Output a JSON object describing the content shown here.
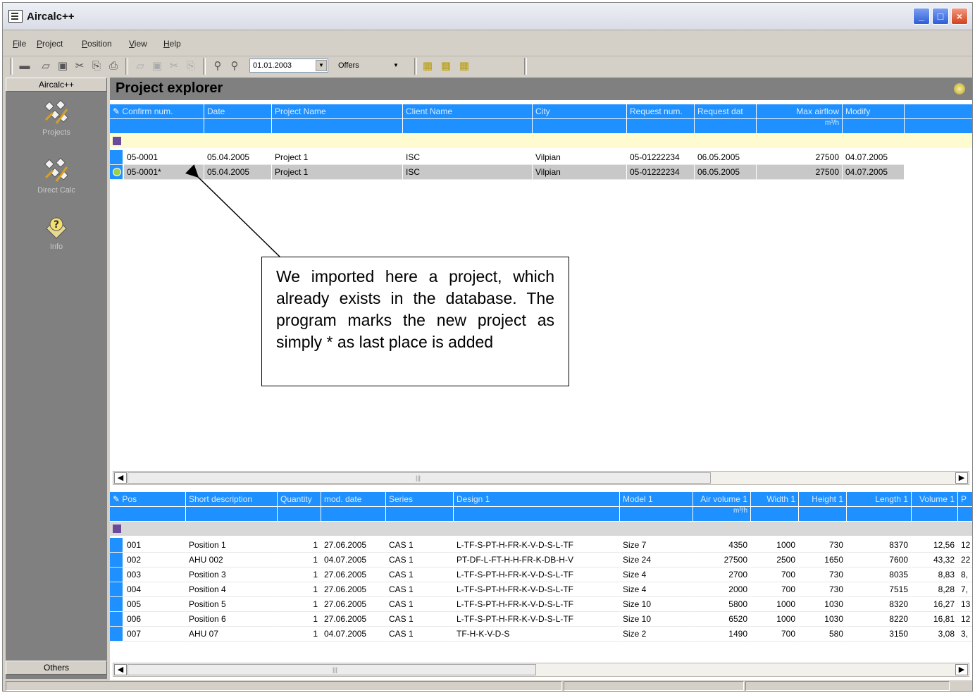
{
  "window": {
    "title": "Aircalc++"
  },
  "menu": [
    "File",
    "Project",
    "Position",
    "View",
    "Help"
  ],
  "toolbar": {
    "date_value": "01.01.2003",
    "offers_value": "Offers"
  },
  "leftbar": {
    "header": "Aircalc++",
    "items": [
      {
        "label": "Projects",
        "icon": "projects-icon"
      },
      {
        "label": "Direct Calc",
        "icon": "direct-calc-icon"
      },
      {
        "label": "Info",
        "icon": "info-icon"
      }
    ],
    "footer": "Others"
  },
  "explorer": {
    "title": "Project explorer"
  },
  "projects": {
    "columns": [
      "Confirm num.",
      "Date",
      "Project Name",
      "Client Name",
      "City",
      "Request num.",
      "Request dat",
      "Max airflow",
      "Modify"
    ],
    "column_sub": [
      "",
      "",
      "",
      "",
      "",
      "",
      "",
      "m³/h",
      ""
    ],
    "rows": [
      [
        "05-0001",
        "05.04.2005",
        "Project 1",
        "ISC",
        "Vilpian",
        "05-01222234",
        "06.05.2005",
        "27500",
        "04.07.2005"
      ],
      [
        "05-0001*",
        "05.04.2005",
        "Project 1",
        "ISC",
        "Vilpian",
        "05-01222234",
        "06.05.2005",
        "27500",
        "04.07.2005"
      ]
    ]
  },
  "positions": {
    "columns": [
      "Pos",
      "Short description",
      "Quantity",
      "mod. date",
      "Series",
      "Design 1",
      "Model 1",
      "Air volume 1",
      "Width 1",
      "Height 1",
      "Length 1",
      "Volume 1",
      "P"
    ],
    "column_sub": [
      "",
      "",
      "",
      "",
      "",
      "",
      "",
      "m³/h",
      "",
      "",
      "",
      "",
      ""
    ],
    "rows": [
      [
        "001",
        "Position 1",
        "1",
        "27.06.2005",
        "CAS 1",
        "L-TF-S-PT-H-FR-K-V-D-S-L-TF",
        "Size 7",
        "4350",
        "1000",
        "730",
        "8370",
        "12,56",
        "12"
      ],
      [
        "002",
        "AHU 002",
        "1",
        "04.07.2005",
        "CAS 1",
        "PT-DF-L-FT-H-H-FR-K-DB-H-V",
        "Size 24",
        "27500",
        "2500",
        "1650",
        "7600",
        "43,32",
        "22"
      ],
      [
        "003",
        "Position 3",
        "1",
        "27.06.2005",
        "CAS 1",
        "L-TF-S-PT-H-FR-K-V-D-S-L-TF",
        "Size 4",
        "2700",
        "700",
        "730",
        "8035",
        "8,83",
        "8,"
      ],
      [
        "004",
        "Position 4",
        "1",
        "27.06.2005",
        "CAS 1",
        "L-TF-S-PT-H-FR-K-V-D-S-L-TF",
        "Size 4",
        "2000",
        "700",
        "730",
        "7515",
        "8,28",
        "7,"
      ],
      [
        "005",
        "Position 5",
        "1",
        "27.06.2005",
        "CAS 1",
        "L-TF-S-PT-H-FR-K-V-D-S-L-TF",
        "Size 10",
        "5800",
        "1000",
        "1030",
        "8320",
        "16,27",
        "13"
      ],
      [
        "006",
        "Position 6",
        "1",
        "27.06.2005",
        "CAS 1",
        "L-TF-S-PT-H-FR-K-V-D-S-L-TF",
        "Size 10",
        "6520",
        "1000",
        "1030",
        "8220",
        "16,81",
        "12"
      ],
      [
        "007",
        "AHU 07",
        "1",
        "04.07.2005",
        "CAS 1",
        "TF-H-K-V-D-S",
        "Size 2",
        "1490",
        "700",
        "580",
        "3150",
        "3,08",
        "3,"
      ]
    ]
  },
  "callout": {
    "text": "We imported here a project, which already exists in the database. The program marks the new project as simply * as last place is added"
  }
}
